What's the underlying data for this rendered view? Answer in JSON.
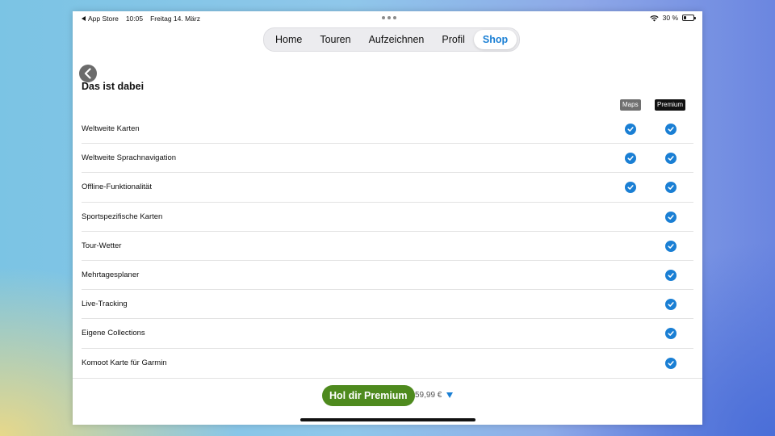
{
  "status_bar": {
    "back_app": "App Store",
    "time": "10:05",
    "date": "Freitag 14. März",
    "battery_percent": "30 %",
    "battery_level": 0.3
  },
  "tabs": [
    {
      "label": "Home",
      "active": false
    },
    {
      "label": "Touren",
      "active": false
    },
    {
      "label": "Aufzeichnen",
      "active": false
    },
    {
      "label": "Profil",
      "active": false
    },
    {
      "label": "Shop",
      "active": true
    }
  ],
  "heading": "Das ist dabei",
  "columns": {
    "maps": "Maps",
    "premium": "Premium"
  },
  "features": [
    {
      "label": "Weltweite Karten",
      "maps": true,
      "premium": true
    },
    {
      "label": "Weltweite Sprachnavigation",
      "maps": true,
      "premium": true
    },
    {
      "label": "Offline-Funktionalität",
      "maps": true,
      "premium": true
    },
    {
      "label": "Sportspezifische Karten",
      "maps": false,
      "premium": true
    },
    {
      "label": "Tour-Wetter",
      "maps": false,
      "premium": true
    },
    {
      "label": "Mehrtagesplaner",
      "maps": false,
      "premium": true
    },
    {
      "label": "Live-Tracking",
      "maps": false,
      "premium": true
    },
    {
      "label": "Eigene Collections",
      "maps": false,
      "premium": true
    },
    {
      "label": "Komoot Karte für Garmin",
      "maps": false,
      "premium": true
    }
  ],
  "footer": {
    "cta_label": "Hol dir Premium",
    "price": "59,99 €"
  },
  "colors": {
    "accent": "#1a7fd4",
    "cta": "#4e8a1e"
  },
  "icons": {
    "back": "chevron-left-icon",
    "check": "checkmark-circle-icon",
    "wifi": "wifi-icon",
    "battery": "battery-icon",
    "dropdown": "triangle-down-icon"
  }
}
